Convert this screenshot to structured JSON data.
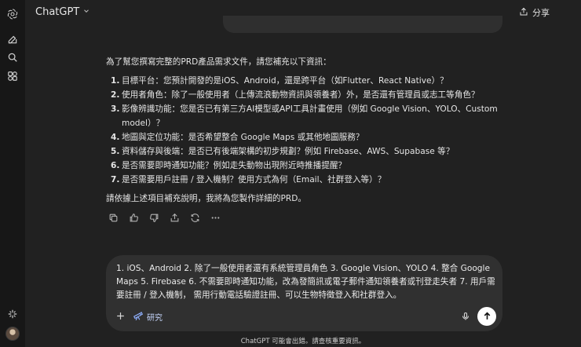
{
  "header": {
    "title": "ChatGPT",
    "share_label": "分享"
  },
  "sidebar": {
    "icons": [
      "openai-logo-icon",
      "new-chat-icon",
      "search-icon",
      "explore-gpts-icon",
      "sparkle-icon"
    ]
  },
  "assistant": {
    "intro": "為了幫您撰寫完整的PRD產品需求文件，請您補充以下資訊：",
    "items": [
      {
        "num": "1.",
        "text": "目標平台：您預計開發的是iOS、Android，還是跨平台（如Flutter、React Native）？"
      },
      {
        "num": "2.",
        "text": "使用者角色：除了一般使用者（上傳流浪動物資訊與領養者）外，是否還有管理員或志工等角色？"
      },
      {
        "num": "3.",
        "text": "影像辨識功能：您是否已有第三方AI模型或API工具計畫使用（例如 Google Vision、YOLO、Custom model）？"
      },
      {
        "num": "4.",
        "text": "地圖與定位功能：是否希望整合 Google Maps 或其他地圖服務？"
      },
      {
        "num": "5.",
        "text": "資料儲存與後端：是否已有後端架構的初步規劃？例如 Firebase、AWS、Supabase 等？"
      },
      {
        "num": "6.",
        "text": "是否需要即時通知功能？例如走失動物出現附近時推播提醒？"
      },
      {
        "num": "7.",
        "text": "是否需要用戶註冊 / 登入機制？使用方式為何（Email、社群登入等）？"
      }
    ],
    "outro": "請依據上述項目補充說明，我將為您製作詳細的PRD。"
  },
  "composer": {
    "value": "1. iOS、Android 2. 除了一般使用者還有系統管理員角色 3. Google Vision、YOLO 4. 整合 Google Maps 5. Firebase 6. 不需要即時通知功能，改為發簡訊或電子郵件通知領養者或刊登走失者 7. 用戶需要註冊 / 登入機制， 需用行動電話驗證註冊、可以生物特徵登入和社群登入。",
    "research_label": "研究"
  },
  "footer": {
    "disclaimer": "ChatGPT 可能會出錯。請查核重要資訊。"
  }
}
